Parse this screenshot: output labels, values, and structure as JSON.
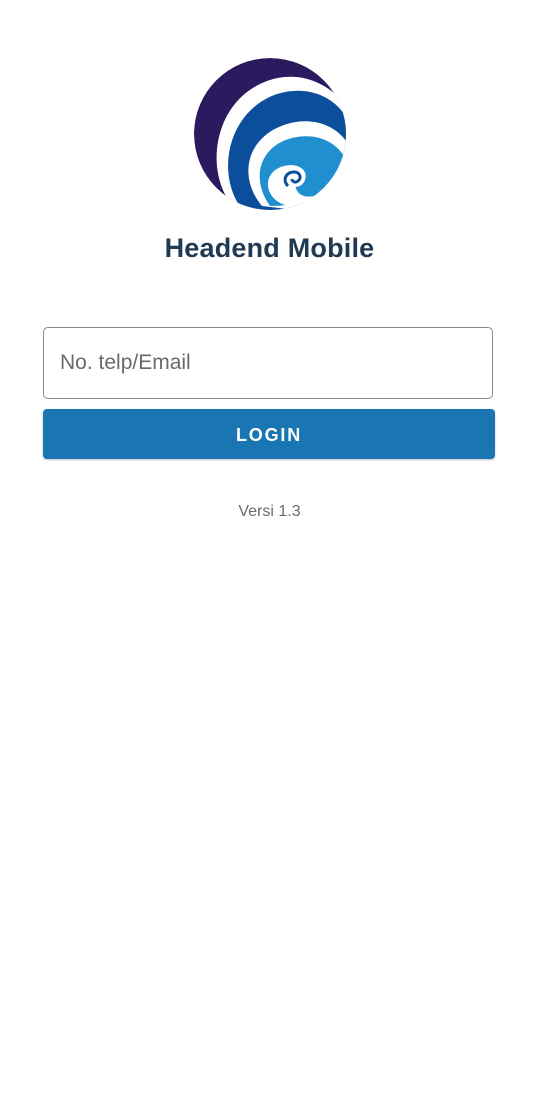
{
  "app": {
    "title": "Headend Mobile",
    "logo_icon": "kominfo-wave-logo-icon",
    "version": "Versi 1.3"
  },
  "login_form": {
    "identifier_placeholder": "No. telp/Email",
    "identifier_value": "",
    "login_label": "LOGIN"
  },
  "colors": {
    "title": "#1f3a52",
    "button": "#1976b3",
    "logo_dark": "#2b1a5e",
    "logo_mid": "#0b4f9c",
    "logo_light": "#1f8fcf"
  }
}
